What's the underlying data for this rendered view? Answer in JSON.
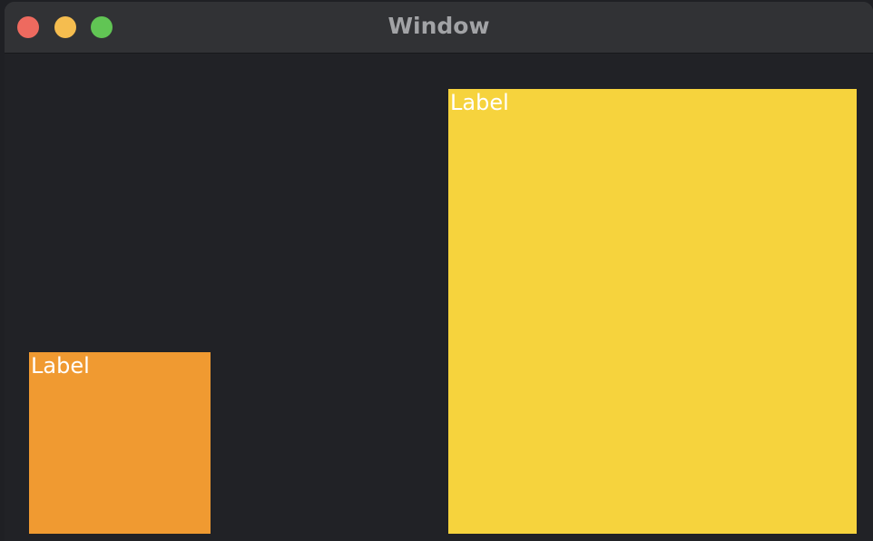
{
  "window": {
    "title": "Window",
    "controls": {
      "close_color": "#ee6a5f",
      "minimize_color": "#f5bd4f",
      "zoom_color": "#61c554"
    }
  },
  "boxes": {
    "left": {
      "label": "Label",
      "color": "#f09a31"
    },
    "right": {
      "label": "Label",
      "color": "#f6d33d"
    }
  }
}
